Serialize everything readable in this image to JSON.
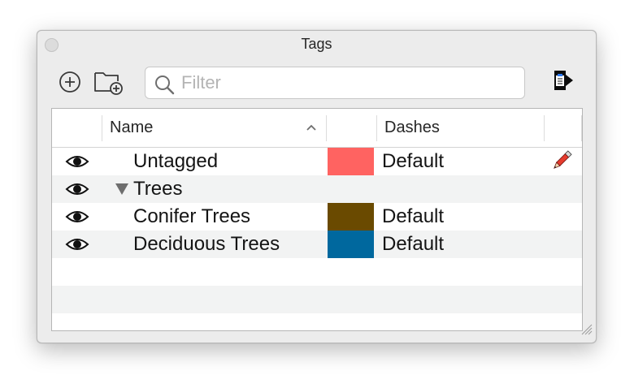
{
  "window": {
    "title": "Tags"
  },
  "toolbar": {
    "add_icon": "add-circle-icon",
    "add_folder_icon": "folder-add-icon",
    "export_icon": "export-arrow-icon"
  },
  "search": {
    "placeholder": "Filter",
    "value": ""
  },
  "table": {
    "columns": [
      "",
      "Name",
      "",
      "Dashes",
      ""
    ],
    "sort": {
      "column": "Name",
      "direction": "ascending"
    },
    "rows": [
      {
        "visible": true,
        "name": "Untagged",
        "color": "#FF6361",
        "dashes": "Default",
        "editable": true,
        "group": false
      },
      {
        "visible": true,
        "name": "Trees",
        "color": null,
        "dashes": "",
        "editable": false,
        "group": true,
        "expanded": true
      },
      {
        "visible": true,
        "name": "Conifer Trees",
        "color": "#6A4A00",
        "dashes": "Default",
        "editable": false,
        "group": false
      },
      {
        "visible": true,
        "name": "Deciduous Trees",
        "color": "#00689E",
        "dashes": "Default",
        "editable": false,
        "group": false
      }
    ]
  }
}
